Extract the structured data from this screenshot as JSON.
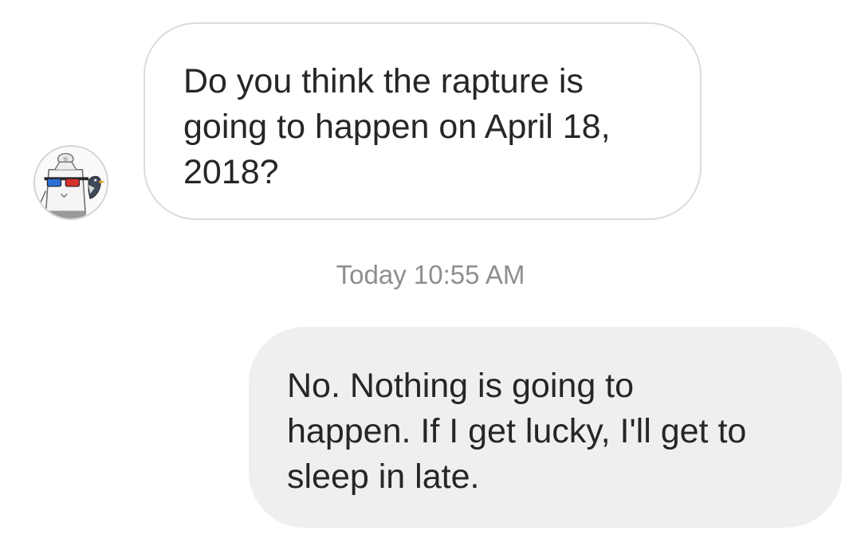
{
  "conversation": {
    "messages": [
      {
        "direction": "received",
        "sender_avatar": "robot-with-3d-glasses-and-bird-avatar",
        "text": "Do you think the rapture is\ngoing to happen on April 18,\n2018?"
      },
      {
        "direction": "sent",
        "text": "No. Nothing is going to\nhappen. If I get lucky, I'll get to\nsleep in late."
      }
    ],
    "timestamp": "Today 10:55 AM"
  },
  "colors": {
    "received_bubble_border": "#dbdbdb",
    "sent_bubble_background": "#efefef",
    "timestamp_text": "#8e8e8e",
    "message_text": "#262626"
  }
}
